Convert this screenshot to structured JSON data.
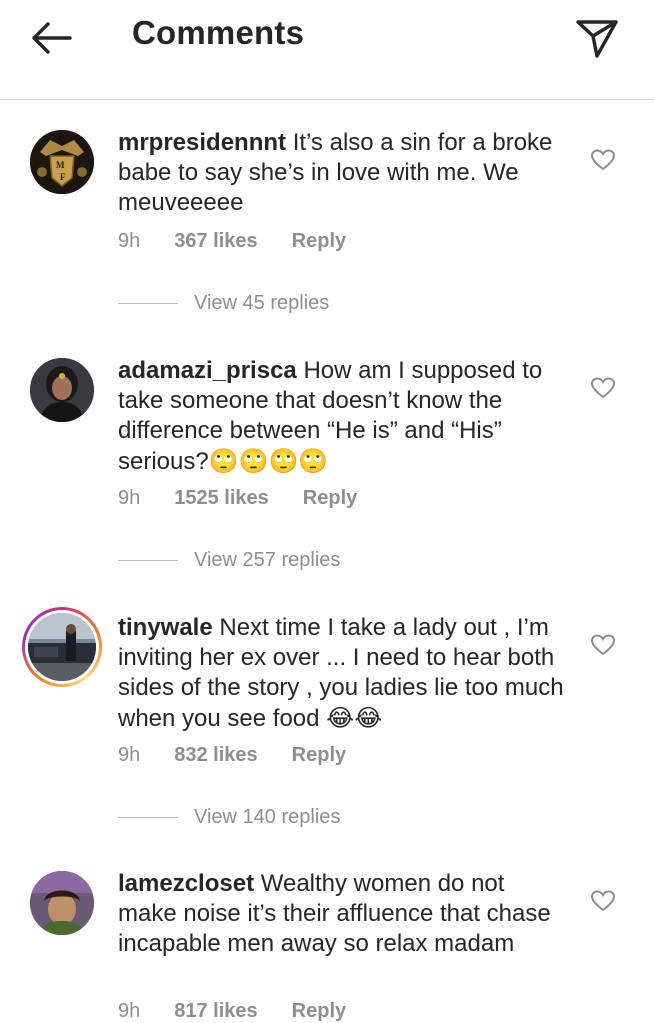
{
  "header": {
    "title": "Comments",
    "back_icon": "arrow-left-icon",
    "send_icon": "paper-plane-icon"
  },
  "comments": [
    {
      "username": "mrpresidennnt",
      "text": " It’s also a sin for a broke babe to say she’s in love with me. We meuveeeee",
      "time": "9h",
      "likes": "367 likes",
      "reply": "Reply",
      "view_replies": "View 45 replies",
      "emoji": ""
    },
    {
      "username": "adamazi_prisca",
      "text": " How am I supposed to take someone that doesn’t know the difference between “He is” and “His” serious?",
      "time": "9h",
      "likes": "1525 likes",
      "reply": "Reply",
      "view_replies": "View 257 replies",
      "emoji": "🙄🙄🙄🙄"
    },
    {
      "username": "tinywale",
      "text": " Next time I take a lady out , I’m inviting her ex over ... I need to hear both sides of the story , you ladies lie too much when you see food ",
      "time": "9h",
      "likes": "832 likes",
      "reply": "Reply",
      "view_replies": "View 140 replies",
      "emoji": "😂😂"
    },
    {
      "username": "lamezcloset",
      "text": " Wealthy women do not make noise it’s their affluence that chase incapable men away so relax madam",
      "time": "9h",
      "likes": "817 likes",
      "reply": "Reply",
      "view_replies": "",
      "emoji": ""
    }
  ],
  "colors": {
    "text": "#262626",
    "meta": "#8e8e8e",
    "divider": "#dbdbdb"
  }
}
